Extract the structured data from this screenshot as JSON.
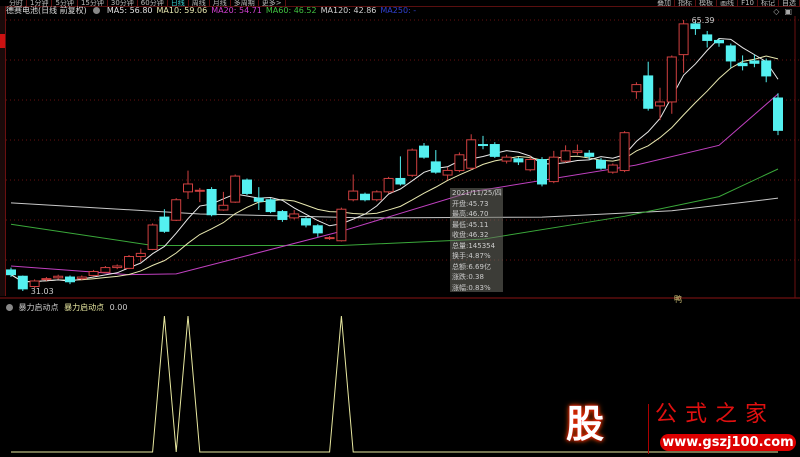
{
  "menu": {
    "left": [
      "分时",
      "1分钟",
      "5分钟",
      "15分钟",
      "30分钟",
      "60分钟",
      "日线",
      "周线",
      "月线",
      "多周期",
      "更多>"
    ],
    "active_index": 6,
    "right": [
      "叠加",
      "指标",
      "模板",
      "画线",
      "F10",
      "标记",
      "自选"
    ]
  },
  "title": {
    "stock": "德赛电池(日线 前复权)",
    "ma": [
      {
        "label": "MA5: 56.80",
        "color": "#e0e0e0"
      },
      {
        "label": "MA10: 59.06",
        "color": "#e8e8b0"
      },
      {
        "label": "MA20: 54.71",
        "color": "#d040d0"
      },
      {
        "label": "MA60: 46.52",
        "color": "#40c040"
      },
      {
        "label": "MA120: 42.86",
        "color": "#d0d0d0"
      },
      {
        "label": "MA250: -",
        "color": "#3040d0"
      }
    ]
  },
  "top_icons": [
    "diamond-icon",
    "window-icon"
  ],
  "annotations": {
    "high": "65.39",
    "low": "31.03"
  },
  "tooltip": [
    "2021/11/25/四",
    "开盘:45.73",
    "最高:46.70",
    "最低:45.11",
    "收盘:46.32",
    "总量:145354",
    "换手:4.87%",
    "总额:6.69亿",
    "涨跌:0.38",
    "涨幅:0.83%"
  ],
  "side_marker": "鸭",
  "indicator": {
    "name": "暴力启动点",
    "line_name": "暴力启动点",
    "value": "0.00",
    "color": "#e8e8a0"
  },
  "watermark": {
    "glyph": "股",
    "title": "公式之家",
    "url": "www.gszj100.com"
  },
  "colors": {
    "up": "#d04040",
    "down": "#54f0f0",
    "grid": "#6a1010"
  },
  "chart_data": {
    "type": "candlestick",
    "price_range": [
      31.03,
      65.39
    ],
    "ohlc": [
      [
        33.7,
        33.1,
        34.0,
        32.8
      ],
      [
        32.9,
        31.3,
        33.0,
        31.03
      ],
      [
        31.6,
        32.3,
        32.5,
        31.4
      ],
      [
        32.5,
        32.6,
        32.8,
        32.3
      ],
      [
        32.7,
        32.9,
        33.1,
        32.5
      ],
      [
        32.8,
        32.2,
        33.0,
        31.9
      ],
      [
        32.6,
        32.8,
        33.0,
        32.4
      ],
      [
        33.0,
        33.5,
        33.7,
        32.9
      ],
      [
        33.4,
        34.0,
        34.2,
        33.3
      ],
      [
        34.0,
        34.2,
        34.4,
        33.8
      ],
      [
        33.9,
        35.4,
        35.6,
        33.8
      ],
      [
        35.4,
        35.8,
        36.4,
        34.7
      ],
      [
        36.3,
        39.4,
        39.6,
        36.2
      ],
      [
        40.4,
        38.6,
        41.4,
        38.4
      ],
      [
        40.0,
        42.6,
        42.8,
        39.9
      ],
      [
        43.6,
        44.6,
        46.3,
        42.7
      ],
      [
        43.7,
        43.8,
        44.1,
        42.3
      ],
      [
        43.9,
        40.7,
        44.2,
        40.5
      ],
      [
        41.3,
        41.9,
        43.6,
        41.2
      ],
      [
        42.3,
        45.6,
        45.8,
        42.2
      ],
      [
        45.1,
        43.4,
        45.3,
        43.2
      ],
      [
        42.8,
        42.4,
        44.2,
        41.3
      ],
      [
        42.6,
        41.1,
        42.8,
        40.9
      ],
      [
        41.1,
        40.1,
        41.3,
        39.8
      ],
      [
        40.3,
        40.8,
        41.3,
        40.1
      ],
      [
        40.2,
        39.4,
        40.4,
        39.1
      ],
      [
        39.3,
        38.4,
        39.5,
        37.9
      ],
      [
        37.7,
        37.8,
        38.0,
        37.5
      ],
      [
        37.4,
        41.4,
        41.6,
        37.3
      ],
      [
        42.6,
        43.7,
        45.8,
        42.4
      ],
      [
        43.3,
        42.6,
        43.5,
        42.4
      ],
      [
        42.6,
        43.6,
        43.8,
        42.4
      ],
      [
        43.6,
        45.3,
        45.5,
        43.4
      ],
      [
        45.3,
        44.6,
        48.1,
        44.4
      ],
      [
        45.7,
        48.9,
        49.1,
        45.5
      ],
      [
        49.4,
        48.0,
        49.8,
        47.8
      ],
      [
        47.4,
        46.1,
        48.9,
        45.9
      ],
      [
        45.73,
        46.32,
        46.7,
        45.11
      ],
      [
        46.3,
        48.3,
        48.6,
        46.1
      ],
      [
        46.6,
        50.2,
        50.9,
        46.4
      ],
      [
        49.6,
        49.5,
        50.7,
        49.0
      ],
      [
        49.6,
        48.1,
        49.9,
        47.9
      ],
      [
        47.5,
        48.0,
        48.3,
        47.2
      ],
      [
        47.8,
        47.4,
        48.0,
        47.0
      ],
      [
        46.4,
        47.7,
        48.1,
        46.2
      ],
      [
        47.7,
        44.6,
        48.0,
        44.3
      ],
      [
        44.9,
        48.0,
        48.8,
        44.7
      ],
      [
        47.5,
        48.8,
        49.5,
        47.3
      ],
      [
        48.6,
        48.8,
        49.6,
        48.3
      ],
      [
        48.5,
        48.1,
        48.9,
        47.7
      ],
      [
        47.6,
        46.6,
        47.9,
        46.4
      ],
      [
        46.1,
        47.0,
        47.2,
        45.9
      ],
      [
        46.3,
        51.1,
        51.3,
        46.1
      ],
      [
        56.3,
        57.2,
        57.5,
        55.4
      ],
      [
        58.3,
        54.2,
        60.1,
        53.9
      ],
      [
        54.5,
        55.0,
        56.8,
        52.7
      ],
      [
        55.0,
        60.7,
        60.9,
        53.5
      ],
      [
        61.0,
        64.9,
        65.39,
        58.7
      ],
      [
        64.9,
        64.3,
        65.3,
        63.5
      ],
      [
        63.5,
        62.8,
        64.0,
        61.9
      ],
      [
        62.8,
        62.5,
        63.0,
        62.0
      ],
      [
        62.1,
        60.2,
        62.4,
        59.3
      ],
      [
        59.9,
        59.6,
        60.9,
        59.0
      ],
      [
        60.2,
        59.9,
        61.0,
        59.4
      ],
      [
        60.2,
        58.3,
        60.5,
        57.5
      ],
      [
        55.5,
        51.4,
        56.1,
        50.8
      ]
    ],
    "ma20": [
      [
        0,
        34.2
      ],
      [
        10,
        33.1
      ],
      [
        14,
        33.2
      ],
      [
        28,
        38.6
      ],
      [
        39,
        43.6
      ],
      [
        53,
        47.0
      ],
      [
        60,
        49.5
      ],
      [
        65,
        56.0
      ]
    ],
    "ma60": [
      [
        0,
        39.5
      ],
      [
        12,
        36.8
      ],
      [
        28,
        36.8
      ],
      [
        40,
        37.6
      ],
      [
        52,
        40.5
      ],
      [
        60,
        43.0
      ],
      [
        65,
        46.5
      ]
    ],
    "ma120": [
      [
        0,
        42.2
      ],
      [
        16,
        40.8
      ],
      [
        30,
        40.3
      ],
      [
        45,
        40.4
      ],
      [
        56,
        41.2
      ],
      [
        65,
        42.8
      ]
    ],
    "signal": [
      0,
      0,
      0,
      0,
      0,
      0,
      0,
      0,
      0,
      0,
      0,
      0,
      0,
      1,
      0,
      1,
      0,
      0,
      0,
      0,
      0,
      0,
      0,
      0,
      0,
      0,
      0,
      0,
      1,
      0,
      0,
      0,
      0,
      0,
      0,
      0,
      0,
      0,
      0,
      0,
      0,
      0,
      0,
      0,
      0,
      0,
      0,
      0,
      0,
      0,
      0,
      0,
      0,
      0,
      0,
      0,
      0,
      0,
      0,
      0,
      0,
      0,
      0,
      0,
      0,
      0
    ]
  }
}
